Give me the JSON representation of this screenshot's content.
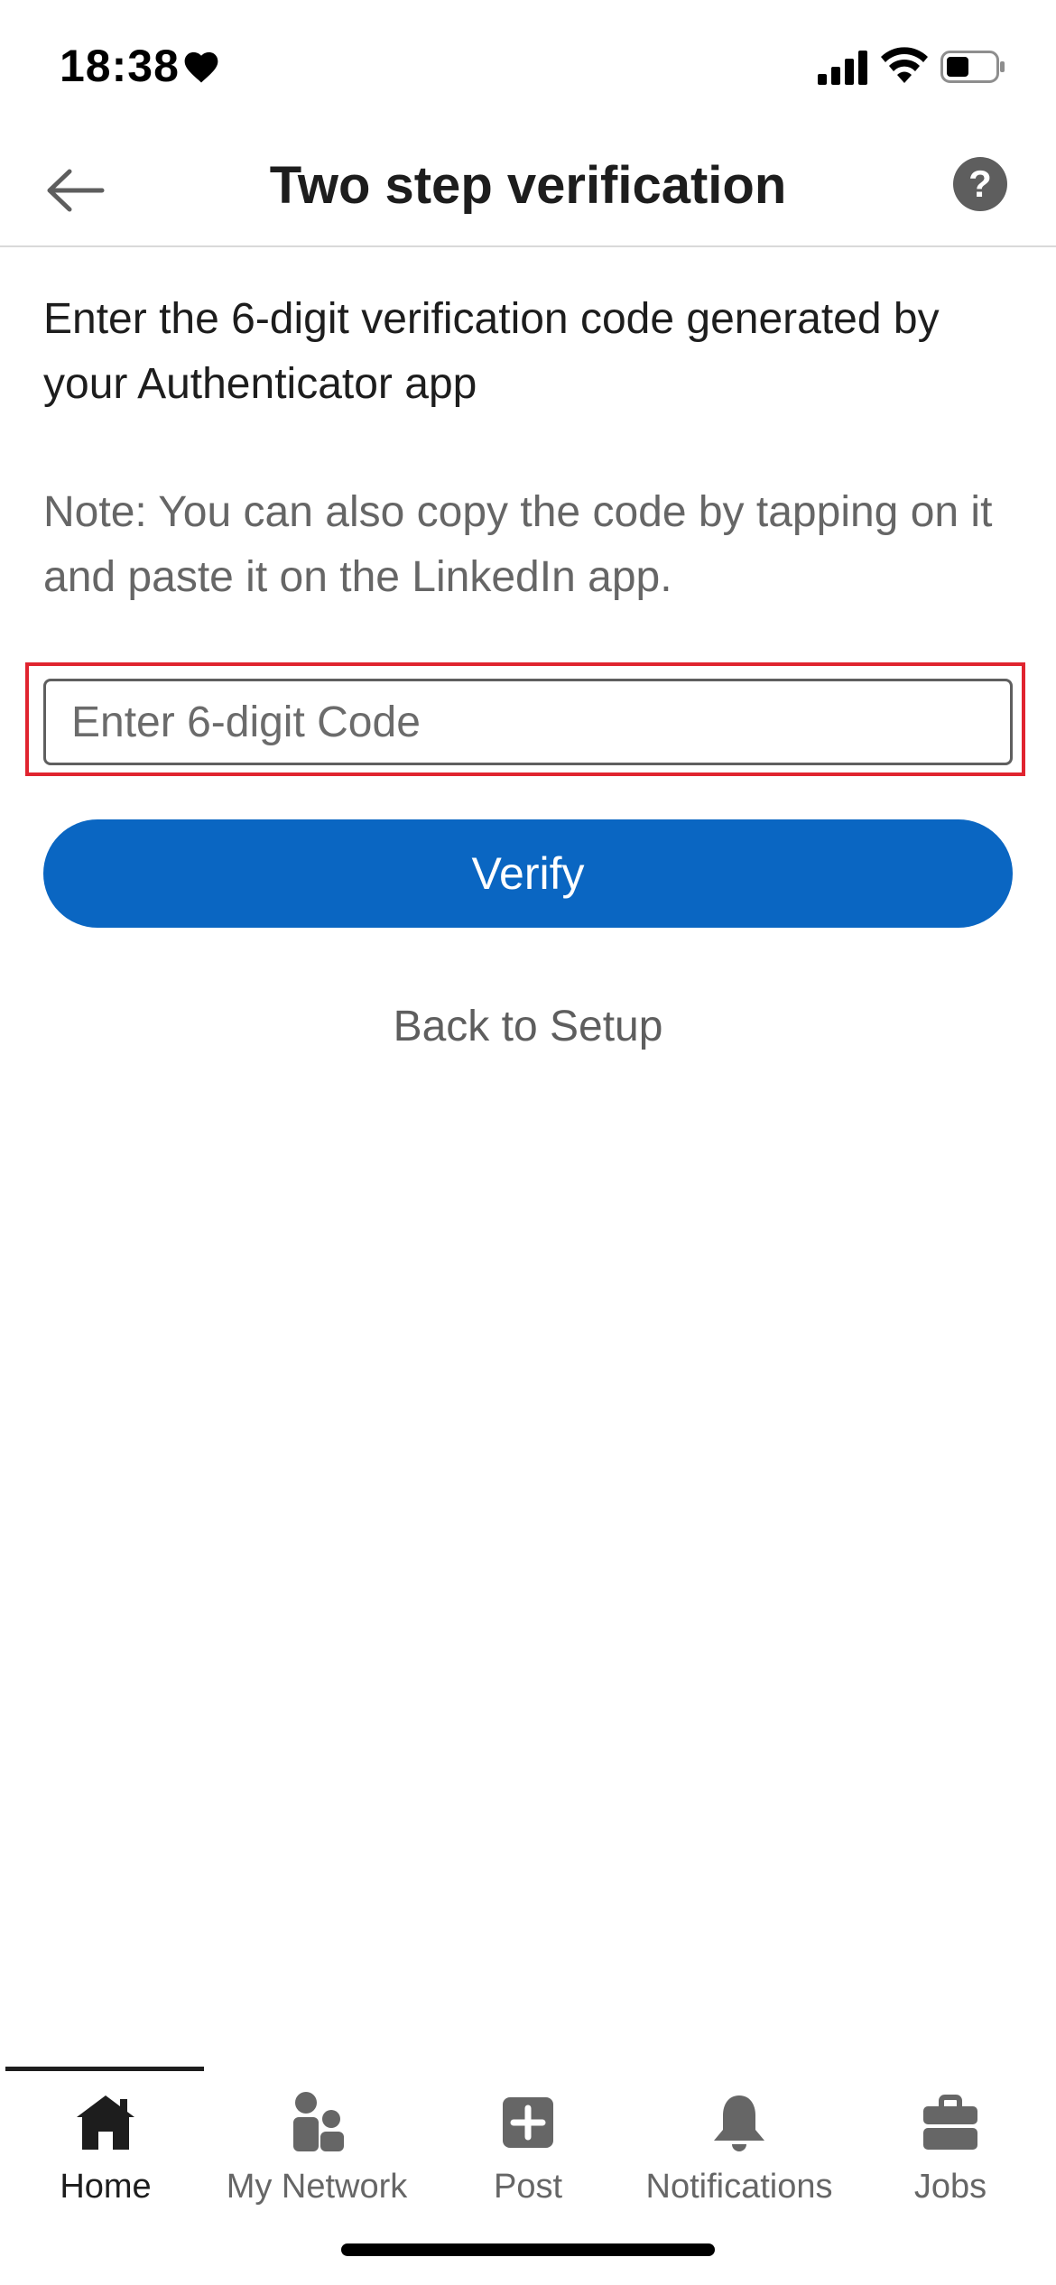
{
  "status_bar": {
    "time": "18:38",
    "icons": [
      "heart-icon",
      "cellular-signal-icon",
      "wifi-icon",
      "battery-icon"
    ]
  },
  "header": {
    "title": "Two step verification",
    "back_icon": "arrow-left-icon",
    "help_label": "?"
  },
  "content": {
    "instruction": "Enter the 6-digit verification code generated by your Authenticator app",
    "note": "Note: You can also copy the code by tapping on it and paste it on the LinkedIn app.",
    "code_input": {
      "value": "",
      "placeholder": "Enter 6-digit Code"
    },
    "verify_label": "Verify",
    "back_to_setup_label": "Back to Setup"
  },
  "bottom_nav": {
    "items": [
      {
        "label": "Home",
        "icon": "home-icon",
        "active": true
      },
      {
        "label": "My Network",
        "icon": "network-icon",
        "active": false
      },
      {
        "label": "Post",
        "icon": "plus-square-icon",
        "active": false
      },
      {
        "label": "Notifications",
        "icon": "bell-icon",
        "active": false
      },
      {
        "label": "Jobs",
        "icon": "briefcase-icon",
        "active": false
      }
    ]
  },
  "colors": {
    "primary": "#0a66c2",
    "highlight_border": "#e0242f",
    "text": "#1d1d1d",
    "muted_text": "#666666"
  }
}
